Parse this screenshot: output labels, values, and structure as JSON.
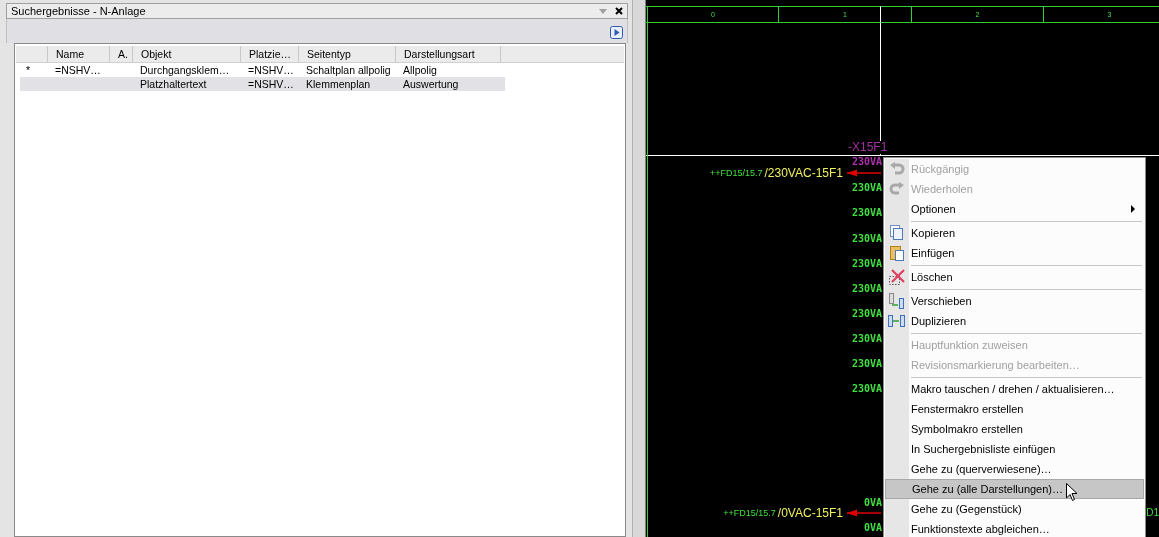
{
  "panel": {
    "title": "Suchergebnisse - N-Anlage"
  },
  "table": {
    "columns": [
      "Name",
      "A.",
      "Objekt",
      "Platzie…",
      "Seitentyp",
      "Darstellungsart"
    ],
    "rows": [
      {
        "mark": "*",
        "name": "=NSHV…",
        "objekt": "Durchgangsklem…",
        "platzie": "=NSHV…",
        "seitentyp": "Schaltplan allpolig",
        "darstellungsart": "Allpolig",
        "selected": false
      },
      {
        "objekt": "Platzhaltertext",
        "platzie": "=NSHV…",
        "seitentyp": "Klemmenplan",
        "darstellungsart": "Auswertung",
        "selected": true
      }
    ]
  },
  "canvas": {
    "ruler": [
      "0",
      "1",
      "2",
      "3"
    ],
    "component_label": "-X15F1",
    "terminals": [
      {
        "text": "230VA",
        "color": "#b030b0"
      },
      {
        "text": "230VA",
        "color": "#40e040"
      },
      {
        "text": "230VA",
        "color": "#40e040"
      },
      {
        "text": "230VA",
        "color": "#40e040"
      },
      {
        "text": "230VA",
        "color": "#40e040"
      },
      {
        "text": "230VA",
        "color": "#40e040"
      },
      {
        "text": "230VA",
        "color": "#40e040"
      },
      {
        "text": "230VA",
        "color": "#40e040"
      },
      {
        "text": "230VA",
        "color": "#40e040"
      },
      {
        "text": "230VA",
        "color": "#40e040"
      },
      {
        "text": "0VA",
        "color": "#40e040"
      },
      {
        "text": "0VA",
        "color": "#40e040"
      }
    ],
    "connections": [
      {
        "source": "++FD15/15.7",
        "target": "/230VAC-15F1"
      },
      {
        "source": "++FD15/15.7",
        "target": "/0VAC-15F1"
      }
    ],
    "edge_label": "D1"
  },
  "context_menu": {
    "sections": [
      [
        {
          "label": "Rückgängig",
          "disabled": true,
          "selected": false
        },
        {
          "label": "Wiederholen",
          "disabled": true,
          "selected": false
        },
        {
          "label": "Optionen",
          "disabled": false,
          "submenu": true,
          "selected": false
        }
      ],
      [
        {
          "label": "Kopieren",
          "disabled": false,
          "selected": false
        },
        {
          "label": "Einfügen",
          "disabled": false,
          "selected": false
        }
      ],
      [
        {
          "label": "Löschen",
          "disabled": false,
          "selected": false
        }
      ],
      [
        {
          "label": "Verschieben",
          "disabled": false,
          "selected": false
        },
        {
          "label": "Duplizieren",
          "disabled": false,
          "selected": false
        }
      ],
      [
        {
          "label": "Hauptfunktion zuweisen",
          "disabled": true,
          "selected": false
        },
        {
          "label": "Revisionsmarkierung bearbeiten…",
          "disabled": true,
          "selected": false
        }
      ],
      [
        {
          "label": "Makro tauschen / drehen / aktualisieren…",
          "disabled": false,
          "selected": false
        },
        {
          "label": "Fenstermakro erstellen",
          "disabled": false,
          "selected": false
        },
        {
          "label": "Symbolmakro erstellen",
          "disabled": false,
          "selected": false
        },
        {
          "label": "In Suchergebnisliste einfügen",
          "disabled": false,
          "selected": false
        },
        {
          "label": "Gehe zu (querverwiesene)…",
          "disabled": false,
          "selected": false
        },
        {
          "label": "Gehe zu (alle Darstellungen)…",
          "disabled": false,
          "selected": true
        },
        {
          "label": "Gehe zu (Gegenstück)",
          "disabled": false,
          "selected": false
        },
        {
          "label": "Funktionstexte abgleichen…",
          "disabled": false,
          "selected": false
        }
      ]
    ]
  }
}
